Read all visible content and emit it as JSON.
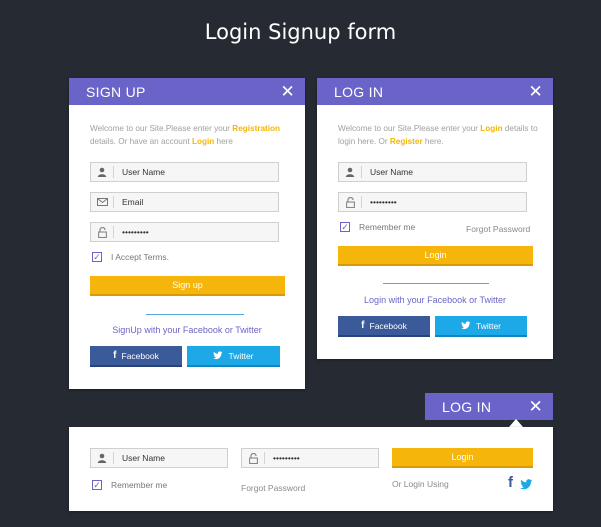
{
  "page": {
    "title": "Login Signup form"
  },
  "colors": {
    "background": "#262b33",
    "accent": "#6b64c8",
    "button": "#f5b50a",
    "facebook": "#3b5a9a",
    "twitter": "#1da8e8",
    "link": "#f2b705"
  },
  "signup": {
    "header": "SIGN UP",
    "intro_part1": "Welcome to our Site.Please enter your ",
    "intro_link1": "Registration",
    "intro_part2": " details. Or have an account ",
    "intro_link2": "Login",
    "intro_part3": " here",
    "username_value": "User Name",
    "email_value": "Email",
    "password_value": "•••••••••",
    "terms_label": "I Accept Terms.",
    "submit_label": "Sign up",
    "social_text": "SignUp with your Facebook or Twitter",
    "facebook_label": "Facebook",
    "twitter_label": "Twitter"
  },
  "login": {
    "header": "LOG IN",
    "intro_part1": "Welcome to our Site.Please enter your ",
    "intro_link1": "Login",
    "intro_part2": " details to login here. Or ",
    "intro_link2": "Register",
    "intro_part3": " here.",
    "username_value": "User Name",
    "password_value": "•••••••••",
    "remember_label": "Remember me",
    "forgot_label": "Forgot Password",
    "submit_label": "Login",
    "social_text": "Login with your Facebook or Twitter",
    "facebook_label": "Facebook",
    "twitter_label": "Twitter"
  },
  "inline_login": {
    "header": "LOG IN",
    "username_value": "User Name",
    "password_value": "•••••••••",
    "remember_label": "Remember me",
    "forgot_label": "Forgot Password",
    "submit_label": "Login",
    "or_login_label": "Or Login Using"
  },
  "icons": {
    "user": "user-icon",
    "email": "envelope-icon",
    "password": "lock-icon",
    "close": "close-icon",
    "check": "check-icon",
    "facebook": "facebook-icon",
    "twitter": "twitter-icon"
  }
}
